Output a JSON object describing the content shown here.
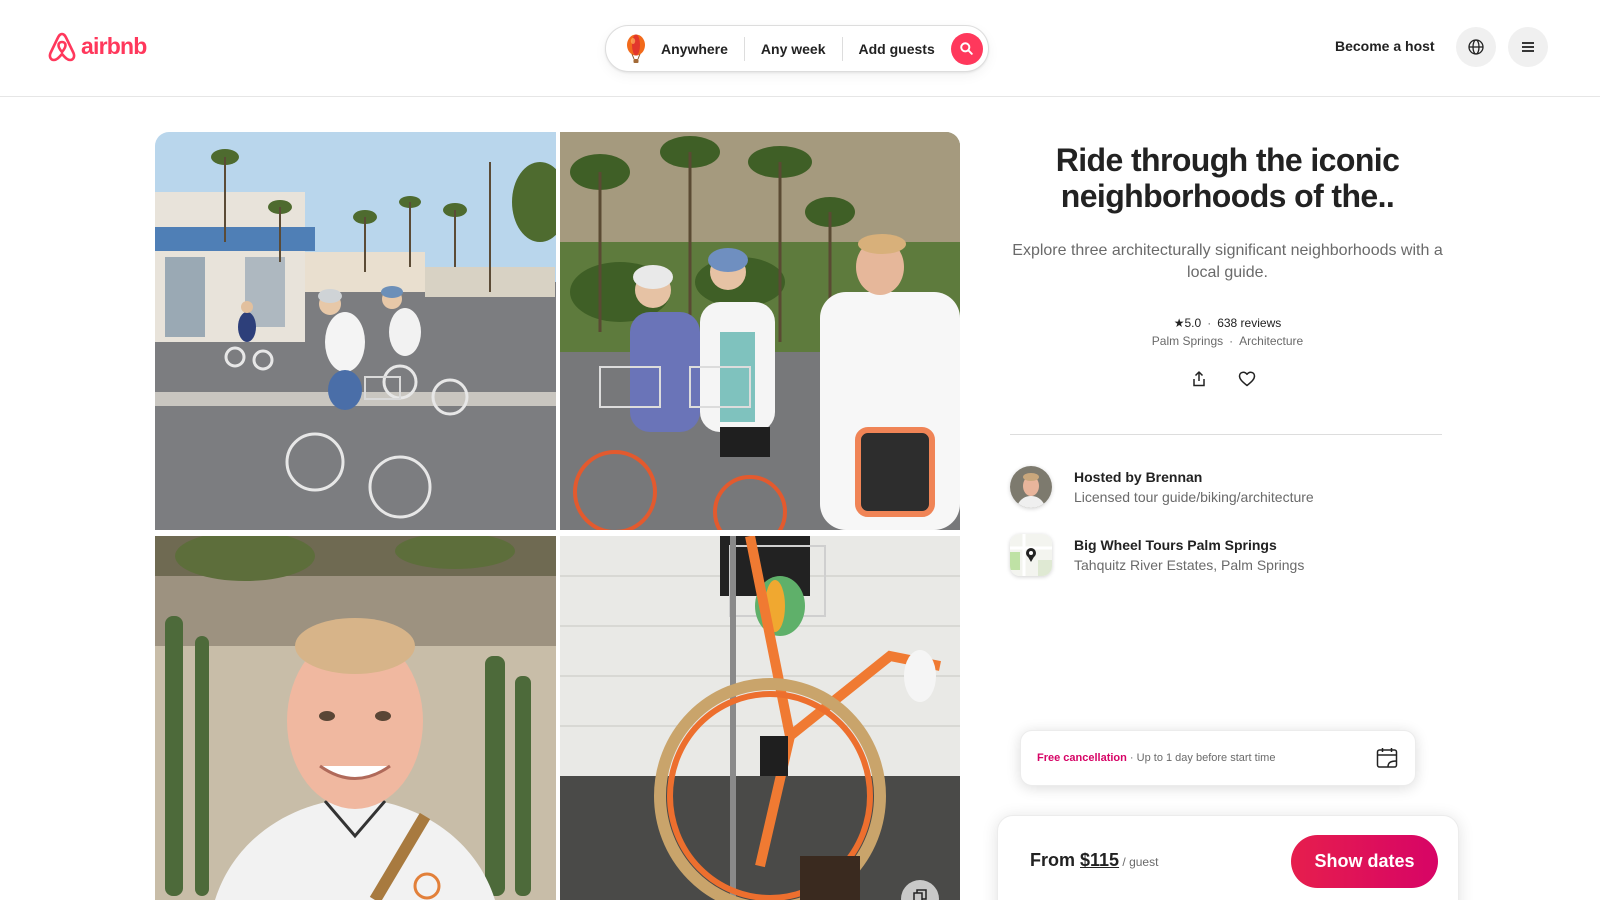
{
  "header": {
    "logo_text": "airbnb",
    "search": {
      "where": "Anywhere",
      "when": "Any week",
      "who": "Add guests"
    },
    "become_host": "Become a host"
  },
  "experience": {
    "title": "Ride through the iconic neighborhoods of the..",
    "subtitle": "Explore three architecturally significant neighborhoods with a local guide.",
    "rating": "★5.0",
    "reviews": "638 reviews",
    "location": "Palm Springs",
    "category": "Architecture"
  },
  "host": {
    "name": "Hosted by Brennan",
    "role": "Licensed tour guide/biking/architecture"
  },
  "venue": {
    "name": "Big Wheel Tours Palm Springs",
    "address": "Tahquitz River Estates, Palm Springs"
  },
  "cancellation": {
    "label": "Free cancellation",
    "detail": " · Up to 1 day before start time"
  },
  "booking": {
    "from_label": "From ",
    "price": "$115",
    "unit": " / guest",
    "button": "Show dates"
  },
  "colors": {
    "brand": "#ff385c",
    "accent": "#e61e4d"
  }
}
